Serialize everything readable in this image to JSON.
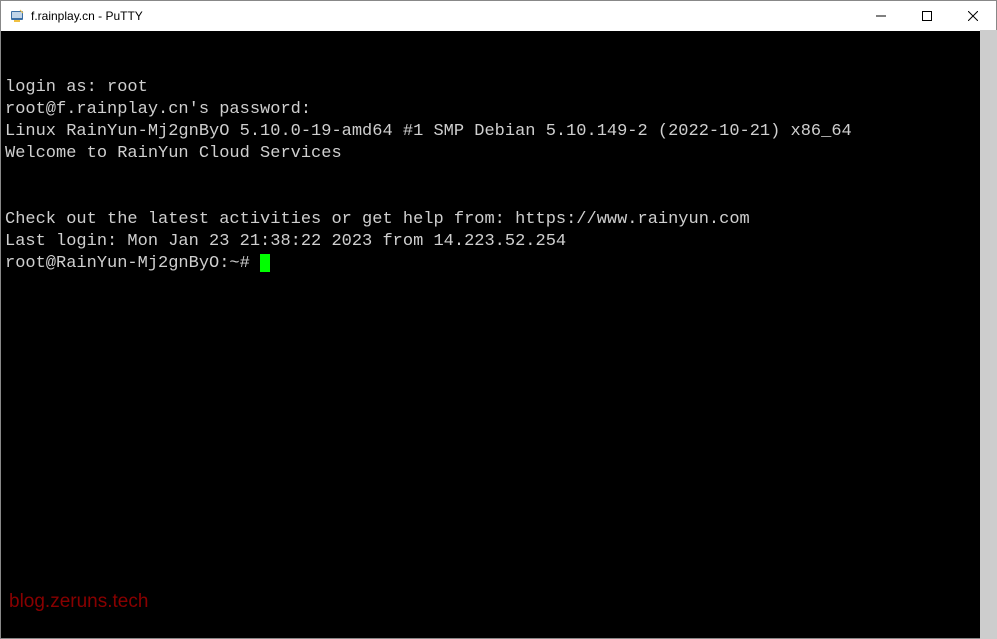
{
  "titlebar": {
    "title": "f.rainplay.cn - PuTTY"
  },
  "terminal": {
    "lines": [
      "login as: root",
      "root@f.rainplay.cn's password:",
      "Linux RainYun-Mj2gnByO 5.10.0-19-amd64 #1 SMP Debian 5.10.149-2 (2022-10-21) x86_64",
      "Welcome to RainYun Cloud Services",
      "",
      "",
      "Check out the latest activities or get help from: https://www.rainyun.com",
      "Last login: Mon Jan 23 21:38:22 2023 from 14.223.52.254"
    ],
    "prompt": "root@RainYun-Mj2gnByO:~# "
  },
  "watermark": "blog.zeruns.tech"
}
